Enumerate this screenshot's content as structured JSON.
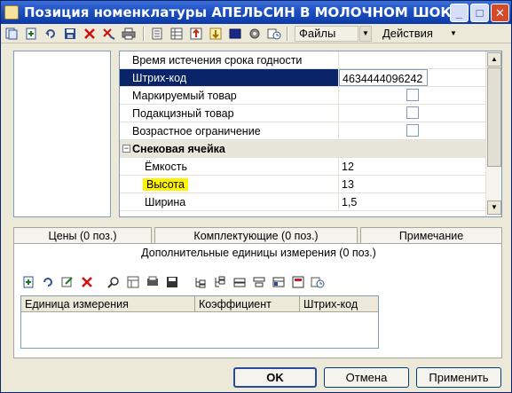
{
  "window": {
    "title": "Позиция номенклатуры АПЕЛЬСИН В МОЛОЧНОМ ШОКОЛАДЕ...",
    "controls": {
      "minimize": "_",
      "maximize": "□",
      "close": "✕"
    }
  },
  "toolbar": {
    "files_menu": "Файлы",
    "actions_menu": "Действия",
    "dropdown_glyph": "▼",
    "icons": [
      "copy-icon",
      "new-icon",
      "refresh-icon",
      "save-icon",
      "delete-icon",
      "clear-icon",
      "print-icon",
      "document-icon",
      "table-icon",
      "export-icon",
      "import-icon",
      "panel-icon",
      "settings-icon",
      "history-icon"
    ]
  },
  "properties": {
    "rows": [
      {
        "name": "Время истечения срока годности",
        "value": ""
      },
      {
        "name": "Штрих-код",
        "value": "4634444096242"
      },
      {
        "name": "Маркируемый товар",
        "value": ""
      },
      {
        "name": "Подакцизный товар",
        "value": ""
      },
      {
        "name": "Возрастное ограничение",
        "value": ""
      }
    ],
    "group": {
      "name": "Снековая ячейка",
      "collapse_glyph": "−"
    },
    "sub_rows": [
      {
        "name": "Ёмкость",
        "value": "12"
      },
      {
        "name": "Высота",
        "value": "13"
      },
      {
        "name": "Ширина",
        "value": "1,5"
      }
    ],
    "scroll_up": "▲",
    "scroll_down": "▼"
  },
  "tabs": [
    {
      "label": "Цены (0 поз.)"
    },
    {
      "label": "Комплектующие (0 поз.)"
    },
    {
      "label": "Примечание"
    }
  ],
  "panel": {
    "title": "Дополнительные единицы измерения (0 поз.)",
    "columns": [
      "Единица измерения",
      "Коэффициент",
      "Штрих-код"
    ]
  },
  "buttons": {
    "ok": "OK",
    "cancel": "Отмена",
    "apply": "Применить"
  },
  "colors": {
    "title_bar": "#1f52c4",
    "selection": "#0a246a",
    "highlight": "#fff200"
  }
}
